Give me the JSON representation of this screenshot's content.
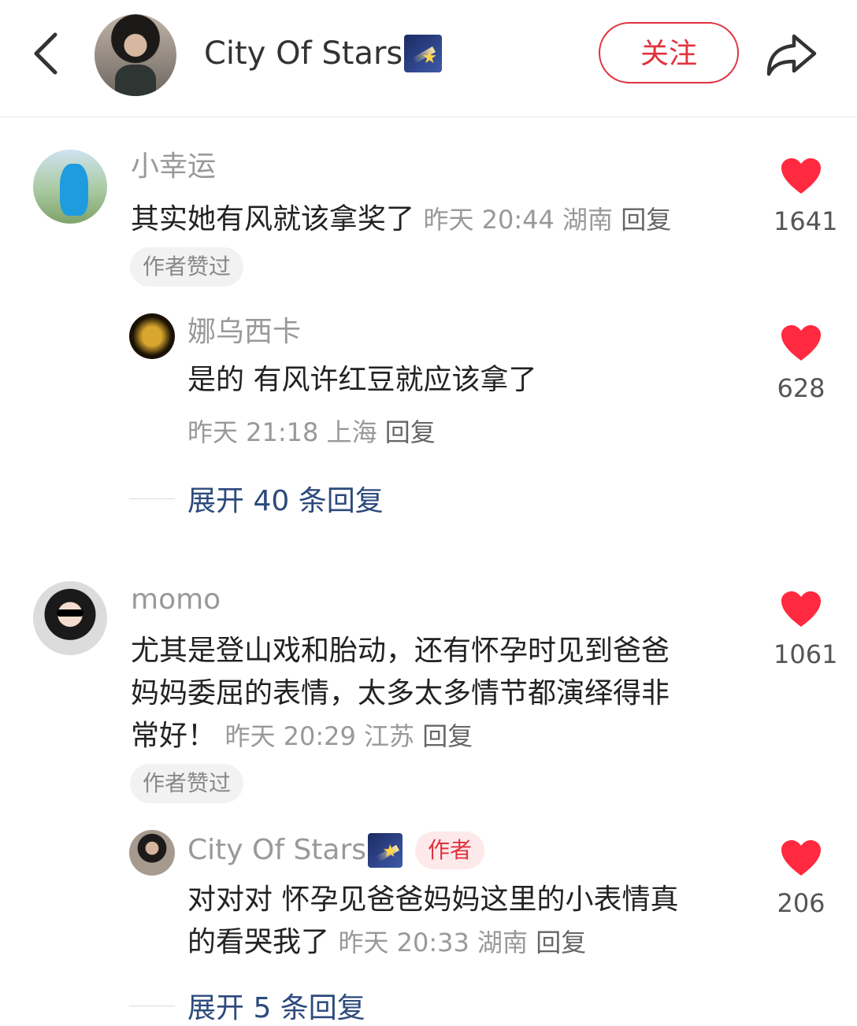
{
  "header": {
    "title": "City Of Stars",
    "follow_label": "关注"
  },
  "comments": [
    {
      "username": "小幸运",
      "text": "其实她有风就该拿奖了",
      "time": "昨天 20:44",
      "location": "湖南",
      "reply_label": "回复",
      "badge": "作者赞过",
      "likes": "1641",
      "replies": [
        {
          "username": "娜乌西卡",
          "text": "是的 有风许红豆就应该拿了",
          "time": "昨天 21:18",
          "location": "上海",
          "reply_label": "回复",
          "likes": "628"
        }
      ],
      "expand_label": "展开 40 条回复"
    },
    {
      "username": "momo",
      "text_lines": [
        "尤其是登山戏和胎动，还有怀孕时见到爸爸",
        "妈妈委屈的表情，太多太多情节都演绎得非",
        "常好！"
      ],
      "time": "昨天 20:29",
      "location": "江苏",
      "reply_label": "回复",
      "badge": "作者赞过",
      "likes": "1061",
      "replies": [
        {
          "username": "City Of Stars",
          "author_tag": "作者",
          "text_lines": [
            "对对对 怀孕见爸爸妈妈这里的小表情真",
            "的看哭我了"
          ],
          "time": "昨天 20:33",
          "location": "湖南",
          "reply_label": "回复",
          "likes": "206"
        }
      ],
      "expand_label": "展开 5 条回复"
    }
  ],
  "colors": {
    "accent_red": "#e0323e",
    "expand_blue": "#2c4a7c",
    "meta_gray": "#999999"
  },
  "icons": [
    "back-icon",
    "share-icon",
    "heart-icon",
    "shooting-star-emoji"
  ]
}
